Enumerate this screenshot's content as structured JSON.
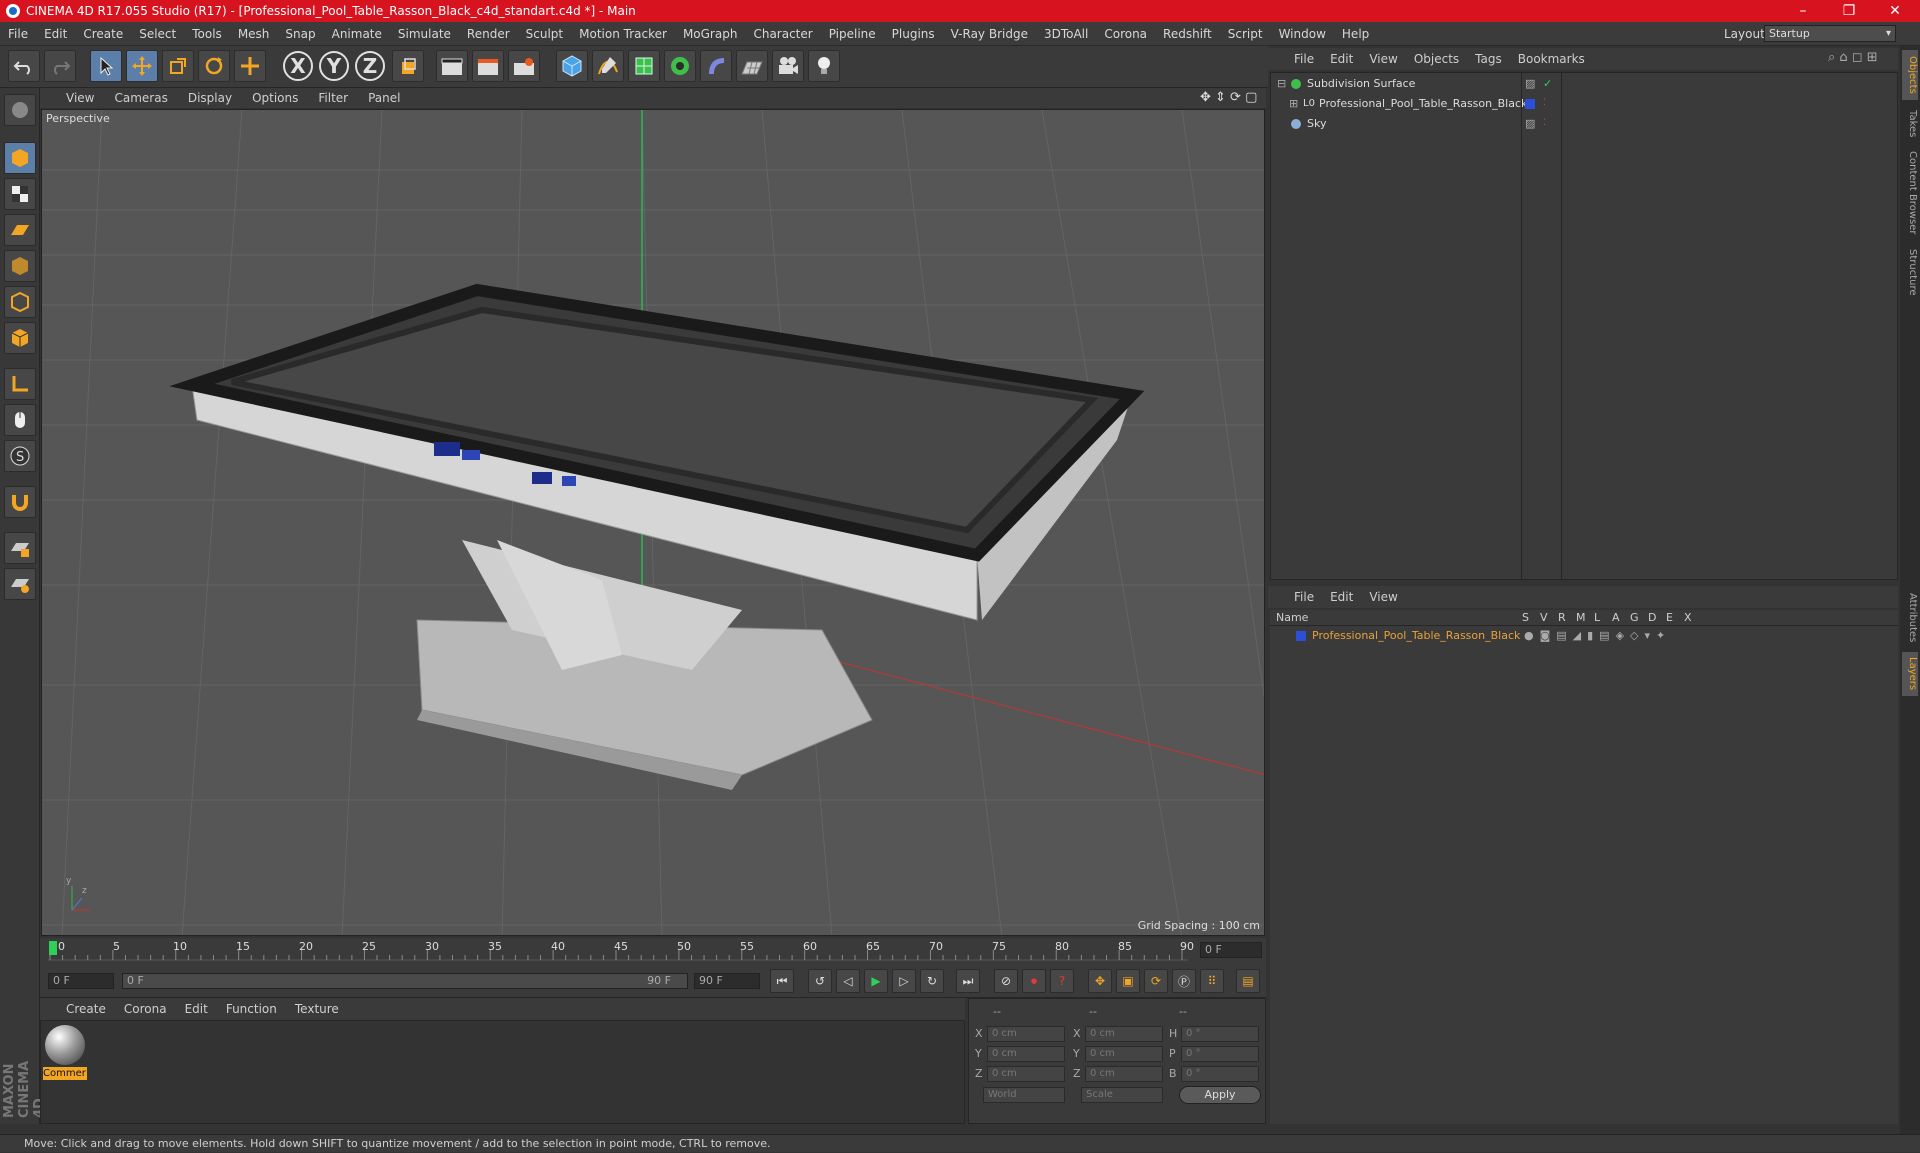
{
  "titlebar": {
    "title": "CINEMA 4D R17.055 Studio (R17) - [Professional_Pool_Table_Rasson_Black_c4d_standart.c4d *] - Main",
    "min": "–",
    "max": "❐",
    "close": "✕"
  },
  "menubar": {
    "items": [
      "File",
      "Edit",
      "Create",
      "Select",
      "Tools",
      "Mesh",
      "Snap",
      "Animate",
      "Simulate",
      "Render",
      "Sculpt",
      "Motion Tracker",
      "MoGraph",
      "Character",
      "Pipeline",
      "Plugins",
      "V-Ray Bridge",
      "3DToAll",
      "Corona",
      "Redshift",
      "Script",
      "Window",
      "Help"
    ],
    "layout_label": "Layout:",
    "layout_value": "Startup"
  },
  "toolbar": {
    "axis_x": "X",
    "axis_y": "Y",
    "axis_z": "Z"
  },
  "viewport": {
    "menu": [
      "View",
      "Cameras",
      "Display",
      "Options",
      "Filter",
      "Panel"
    ],
    "label": "Perspective",
    "grid_spacing": "Grid Spacing : 100 cm",
    "axis_y": "y",
    "axis_z": "z"
  },
  "timeline": {
    "ticks": [
      "0",
      "5",
      "10",
      "15",
      "20",
      "25",
      "30",
      "35",
      "40",
      "45",
      "50",
      "55",
      "60",
      "65",
      "70",
      "75",
      "80",
      "85",
      "90"
    ],
    "current_frame": "0 F",
    "start_field": "0 F",
    "range_start": "0 F",
    "range_end": "90 F",
    "end_field": "90 F"
  },
  "material_manager": {
    "menu": [
      "Create",
      "Corona",
      "Edit",
      "Function",
      "Texture"
    ],
    "material_name": "Commer"
  },
  "coordinates": {
    "header1": "--",
    "header2": "--",
    "header3": "--",
    "rows": [
      {
        "l1": "X",
        "v1": "0 cm",
        "l2": "X",
        "v2": "0 cm",
        "l3": "H",
        "v3": "0 °"
      },
      {
        "l1": "Y",
        "v1": "0 cm",
        "l2": "Y",
        "v2": "0 cm",
        "l3": "P",
        "v3": "0 °"
      },
      {
        "l1": "Z",
        "v1": "0 cm",
        "l2": "Z",
        "v2": "0 cm",
        "l3": "B",
        "v3": "0 °"
      }
    ],
    "world": "World",
    "scale": "Scale",
    "apply": "Apply"
  },
  "object_manager": {
    "menu": [
      "File",
      "Edit",
      "View",
      "Objects",
      "Tags",
      "Bookmarks"
    ],
    "objects": [
      {
        "name": "Subdivision Surface"
      },
      {
        "name": "Professional_Pool_Table_Rasson_Black"
      },
      {
        "name": "Sky"
      }
    ]
  },
  "layer_manager": {
    "menu": [
      "File",
      "Edit",
      "View"
    ],
    "col_name": "Name",
    "cols": [
      "S",
      "V",
      "R",
      "M",
      "L",
      "A",
      "G",
      "D",
      "E",
      "X"
    ],
    "layer_name": "Professional_Pool_Table_Rasson_Black",
    "layer_color": "#2b4fd6",
    "layer_text_color": "#e8a13a"
  },
  "sidetabs": [
    "Objects",
    "Takes",
    "Content Browser",
    "Structure",
    "Attributes",
    "Layers"
  ],
  "maxon": "MAXON CINEMA 4D",
  "status": "Move: Click and drag to move elements. Hold down SHIFT to quantize movement / add to the selection in point mode, CTRL to remove."
}
